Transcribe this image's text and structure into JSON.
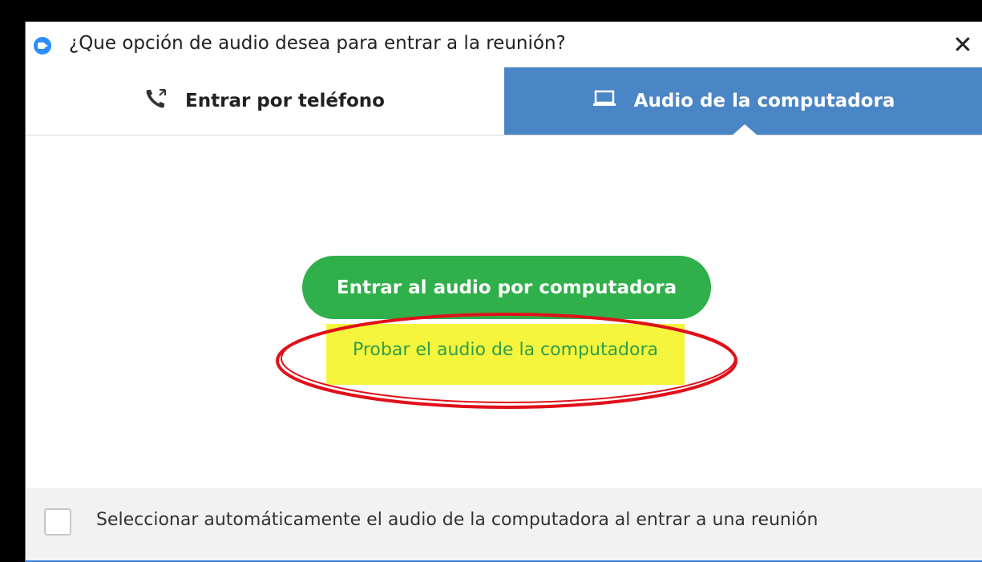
{
  "window": {
    "title": "¿Que opción de audio desea para entrar a la reunión?",
    "close_glyph": "✕"
  },
  "tabs": [
    {
      "label": "Entrar por teléfono",
      "icon": "phone-icon",
      "selected": false
    },
    {
      "label": "Audio de la computadora",
      "icon": "laptop-icon",
      "selected": true
    }
  ],
  "main": {
    "join_button_label": "Entrar al audio por computadora",
    "test_link_label": "Probar el audio de la computadora"
  },
  "footer": {
    "auto_select_label": "Seleccionar automáticamente el audio de la computadora al entrar a una reunión",
    "auto_select_checked": false
  },
  "colors": {
    "tab_active": "#4a86c5",
    "join_button": "#2fb04a",
    "test_link": "#2f9e4a",
    "highlight": "#f4f53c",
    "annotation_ellipse": "#e0101a"
  }
}
